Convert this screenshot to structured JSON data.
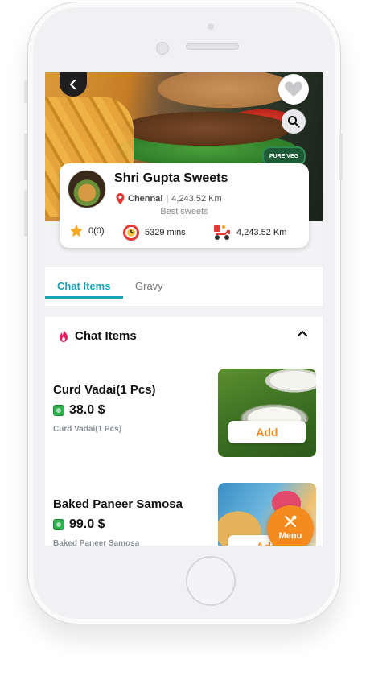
{
  "restaurant": {
    "name": "Shri Gupta Sweets",
    "city": "Chennai",
    "distance": "4,243.52 Km",
    "separator": "|",
    "tagline": "Best sweets",
    "badge": "PURE VEG"
  },
  "stats": {
    "rating": "0(0)",
    "delivery_time": "5329 mins",
    "delivery_distance": "4,243.52 Km"
  },
  "tabs": [
    {
      "label": "Chat Items",
      "active": true
    },
    {
      "label": "Gravy",
      "active": false
    }
  ],
  "section": {
    "title": "Chat Items"
  },
  "items": [
    {
      "name": "Curd Vadai(1 Pcs)",
      "price": "38.0 $",
      "description": "Curd Vadai(1 Pcs)",
      "add_label": "Add"
    },
    {
      "name": "Baked Paneer Samosa",
      "price": "99.0 $",
      "description": "Baked Paneer Samosa",
      "add_label": "Add"
    }
  ],
  "fab": {
    "label": "Menu"
  },
  "colors": {
    "accent": "#17a2b8",
    "orange": "#f58a1f",
    "veg": "#2bb24c"
  }
}
